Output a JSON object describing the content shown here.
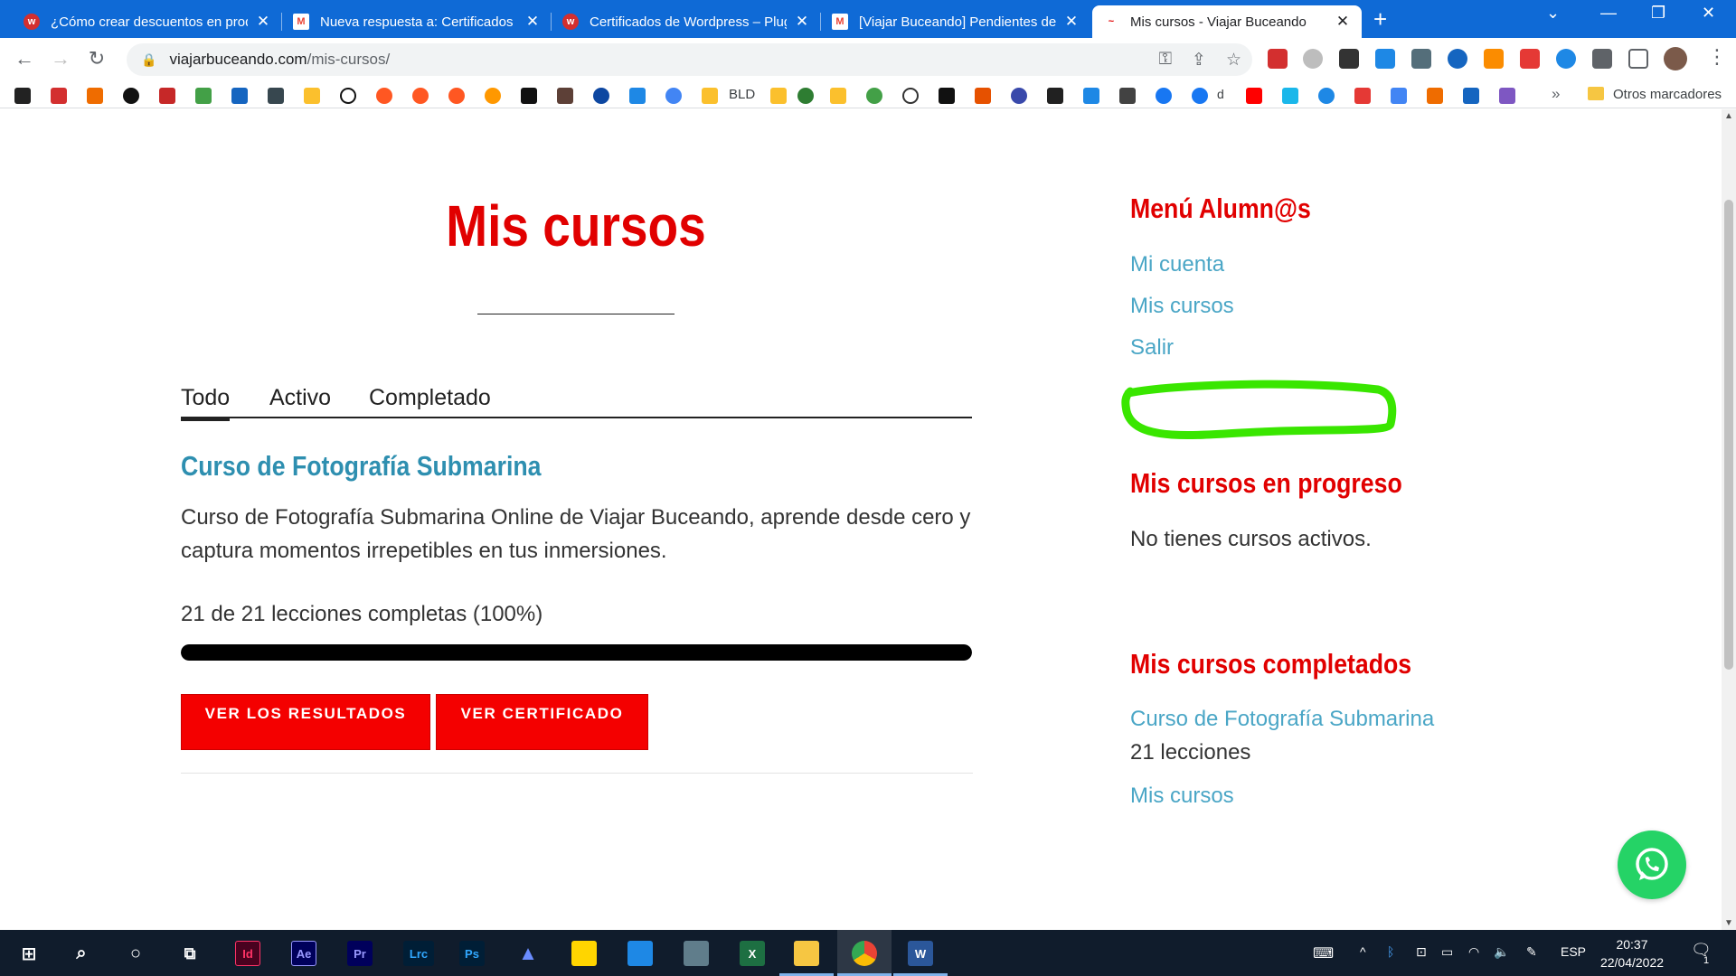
{
  "browser": {
    "tabs": [
      {
        "title": "¿Cómo crear descuentos en prod",
        "favicon_color": "#d32f2f",
        "favicon_glyph": "w"
      },
      {
        "title": "Nueva respuesta a: Certificados d",
        "favicon_color": "#ea4335",
        "favicon_glyph": "M"
      },
      {
        "title": "Certificados de Wordpress – Plug",
        "favicon_color": "#d32f2f",
        "favicon_glyph": "w"
      },
      {
        "title": "[Viajar Buceando] Pendientes de",
        "favicon_color": "#ea4335",
        "favicon_glyph": "M"
      },
      {
        "title": "Mis cursos - Viajar Buceando",
        "favicon_color": "#e10000",
        "favicon_glyph": "~"
      }
    ],
    "url_host": "viajarbuceando.com",
    "url_path": "/mis-cursos/",
    "bookmarks_other": "Otros marcadores",
    "bookmark_labels": [
      "BLD",
      "d"
    ]
  },
  "page": {
    "title": "Mis cursos",
    "tabs": [
      "Todo",
      "Activo",
      "Completado"
    ],
    "course": {
      "title": "Curso de Fotografía Submarina",
      "description": "Curso de Fotografía Submarina Online de Viajar Buceando, aprende desde cero y captura momentos irrepetibles en tus inmersiones.",
      "progress_text": "21 de 21 lecciones completas (100%)",
      "progress_percent": 100
    },
    "buttons": {
      "results": "VER LOS RESULTADOS",
      "certificate": "VER CERTIFICADO"
    }
  },
  "sidebar": {
    "menu_heading": "Menú Alumn@s",
    "menu_links": [
      "Mi cuenta",
      "Mis cursos",
      "Salir"
    ],
    "progress_heading": "Mis cursos en progreso",
    "progress_empty": "No tienes cursos activos.",
    "completed_heading": "Mis cursos completados",
    "completed_course": "Curso de Fotografía Submarina",
    "completed_lessons": "21 lecciones",
    "completed_link": "Mis cursos"
  },
  "taskbar": {
    "apps": [
      "Id",
      "Ae",
      "Pr",
      "Lrc",
      "Ps"
    ],
    "language": "ESP",
    "time": "20:37",
    "date": "22/04/2022",
    "notifications": "1"
  },
  "colors": {
    "brand_red": "#e10000",
    "link_blue": "#4aa6c6",
    "course_title_blue": "#2e8fb0",
    "button_red": "#f40000",
    "highlight_green": "#39e600"
  }
}
